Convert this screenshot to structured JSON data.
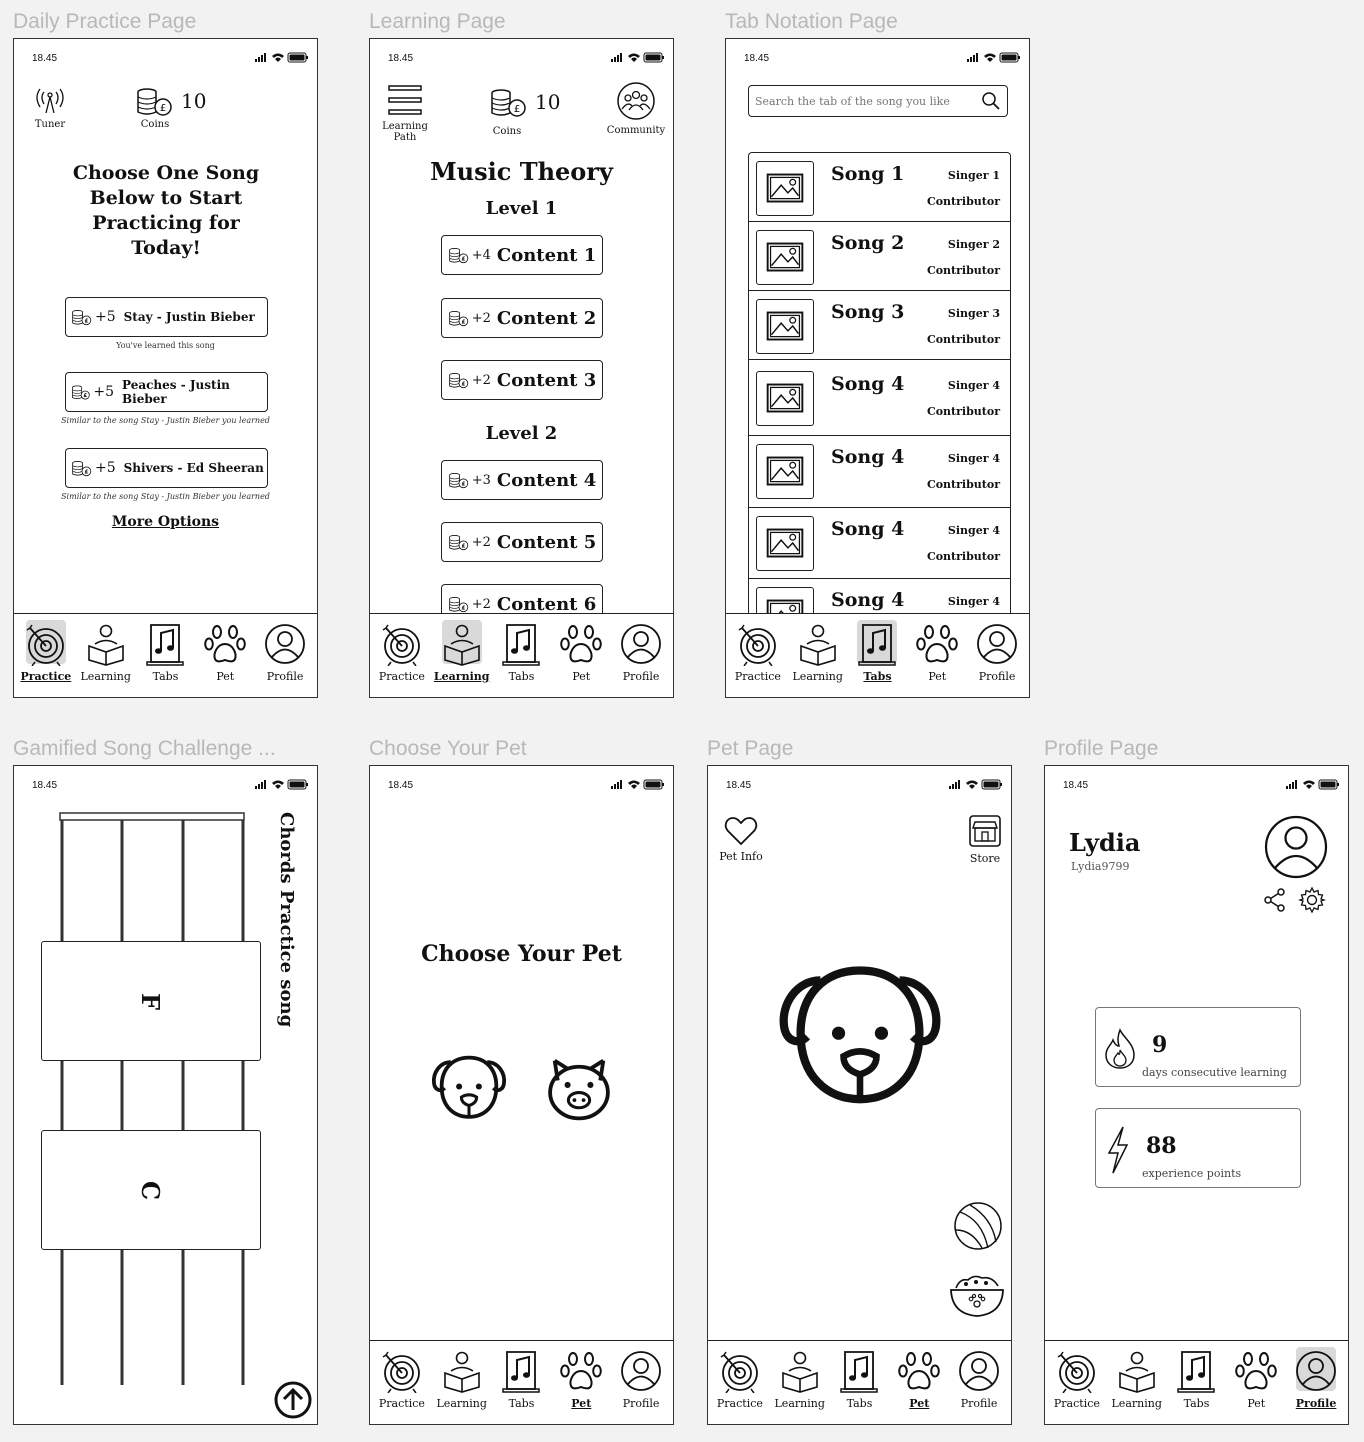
{
  "frames": {
    "daily": {
      "label": "Daily Practice Page"
    },
    "learning": {
      "label": "Learning Page"
    },
    "tabs": {
      "label": "Tab Notation Page"
    },
    "gamified": {
      "label": "Gamified Song Challenge ..."
    },
    "choose_pet": {
      "label": "Choose Your Pet"
    },
    "pet": {
      "label": "Pet Page"
    },
    "profile": {
      "label": "Profile Page"
    }
  },
  "status_time": "18.45",
  "nav": {
    "practice": "Practice",
    "learning": "Learning",
    "tabs": "Tabs",
    "pet": "Pet",
    "profile": "Profile"
  },
  "daily": {
    "tuner_label": "Tuner",
    "coins_label": "Coins",
    "coins_value": "10",
    "title": "Choose One Song Below to Start Practicing for Today!",
    "songs": [
      {
        "reward": "+5",
        "name": "Stay - Justin Bieber",
        "note": "You've learned this song"
      },
      {
        "reward": "+5",
        "name": "Peaches - Justin Bieber",
        "note": "Similar to the song Stay - Justin Bieber you learned"
      },
      {
        "reward": "+5",
        "name": "Shivers - Ed Sheeran",
        "note": "Similar to the song Stay - Justin Bieber you learned"
      }
    ],
    "more_options": "More Options"
  },
  "learning": {
    "path_label": "Learning Path",
    "coins_label": "Coins",
    "coins_value": "10",
    "community_label": "Community",
    "title": "Music Theory",
    "level1": "Level 1",
    "level2": "Level 2",
    "contents": [
      {
        "reward": "+4",
        "name": "Content 1"
      },
      {
        "reward": "+2",
        "name": "Content 2"
      },
      {
        "reward": "+2",
        "name": "Content 3"
      },
      {
        "reward": "+3",
        "name": "Content 4"
      },
      {
        "reward": "+2",
        "name": "Content 5"
      },
      {
        "reward": "+2",
        "name": "Content 6"
      }
    ]
  },
  "tabs_page": {
    "search_placeholder": "Search the tab of the song you like",
    "songs": [
      {
        "title": "Song 1",
        "singer": "Singer 1",
        "contributor": "Contributor"
      },
      {
        "title": "Song 2",
        "singer": "Singer 2",
        "contributor": "Contributor"
      },
      {
        "title": "Song 3",
        "singer": "Singer 3",
        "contributor": "Contributor"
      },
      {
        "title": "Song 4",
        "singer": "Singer 4",
        "contributor": "Contributor"
      },
      {
        "title": "Song 4",
        "singer": "Singer 4",
        "contributor": "Contributor"
      },
      {
        "title": "Song 4",
        "singer": "Singer 4",
        "contributor": "Contributor"
      },
      {
        "title": "Song 4",
        "singer": "Singer 4",
        "contributor": ""
      }
    ]
  },
  "gamified": {
    "title": "Chords Practice song",
    "chord1": "F",
    "chord2": "C"
  },
  "choose_pet": {
    "title": "Choose Your Pet"
  },
  "pet_page": {
    "pet_info": "Pet Info",
    "store": "Store"
  },
  "profile": {
    "name": "Lydia",
    "username": "Lydia9799",
    "streak_value": "9",
    "streak_label": "days consecutive learning",
    "xp_value": "88",
    "xp_label": "experience points"
  }
}
